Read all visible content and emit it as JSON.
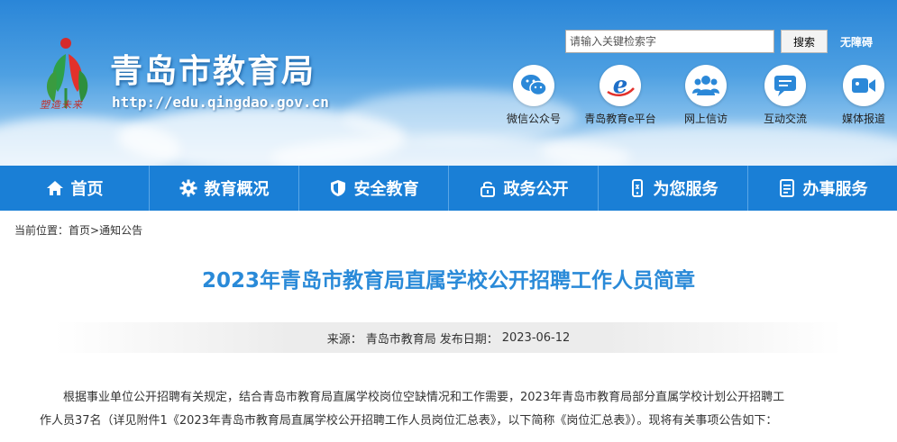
{
  "header": {
    "site_title": "青岛市教育局",
    "site_url": "http://edu.qingdao.gov.cn",
    "logo_text": "塑造未来",
    "search_placeholder": "请输入关键检索字",
    "search_button": "搜索",
    "accessibility_link": "无障碍",
    "quick_links": [
      {
        "label": "微信公众号",
        "icon": "wechat-icon"
      },
      {
        "label": "青岛教育e平台",
        "icon": "e-platform-icon"
      },
      {
        "label": "网上信访",
        "icon": "people-icon"
      },
      {
        "label": "互动交流",
        "icon": "chat-icon"
      },
      {
        "label": "媒体报道",
        "icon": "video-icon"
      }
    ]
  },
  "nav": {
    "items": [
      {
        "label": "首页",
        "icon": "home-icon"
      },
      {
        "label": "教育概况",
        "icon": "gear-icon"
      },
      {
        "label": "安全教育",
        "icon": "shield-icon"
      },
      {
        "label": "政务公开",
        "icon": "lock-icon"
      },
      {
        "label": "为您服务",
        "icon": "phone-icon"
      },
      {
        "label": "办事服务",
        "icon": "document-icon"
      }
    ]
  },
  "breadcrumb": {
    "prefix": "当前位置：",
    "home": "首页",
    "sep": ">",
    "current": "通知公告"
  },
  "article": {
    "title": "2023年青岛市教育局直属学校公开招聘工作人员简章",
    "source_label": "来源：",
    "source": "青岛市教育局",
    "date_label": "发布日期：",
    "date": "2023-06-12",
    "paragraph_line1": "根据事业单位公开招聘有关规定，结合青岛市教育局直属学校岗位空缺情况和工作需要，2023年青岛市教育局部分直属学校计划公开招聘工",
    "paragraph_line2": "作人员37名（详见附件1《2023年青岛市教育局直属学校公开招聘工作人员岗位汇总表》，以下简称《岗位汇总表》）。现将有关事项公告如下："
  },
  "colors": {
    "nav_bg": "#1a7fd6",
    "title_blue": "#2a8ad8",
    "banner_top": "#2a86d8"
  }
}
